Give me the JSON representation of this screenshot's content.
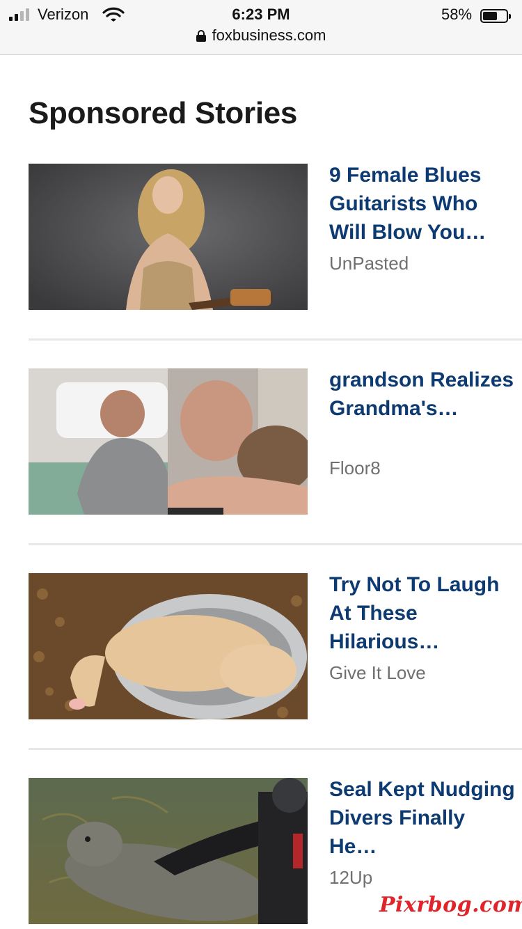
{
  "status_bar": {
    "carrier": "Verizon",
    "time": "6:23 PM",
    "battery": "58%"
  },
  "browser": {
    "url": "foxbusiness.com"
  },
  "section": {
    "heading": "Sponsored Stories"
  },
  "stories": [
    {
      "title": "9 Female Blues Guitarists Who Will Blow You…",
      "source": "UnPasted",
      "image": "woman with guitar photo"
    },
    {
      "title": "grandson Realizes Grandma's…",
      "source": "Floor8",
      "image": "man in hospital bed crying photo"
    },
    {
      "title": "Try Not To Laugh At These Hilarious…",
      "source": "Give It Love",
      "image": "puppy sleeping in food bowl photo"
    },
    {
      "title": "Seal Kept Nudging Divers Finally He…",
      "source": "12Up",
      "image": "seal and diver underwater photo"
    }
  ],
  "watermark": "Pixrbog.com",
  "colors": {
    "title": "#0e3a72",
    "source": "#707070",
    "watermark": "#e0242a"
  }
}
